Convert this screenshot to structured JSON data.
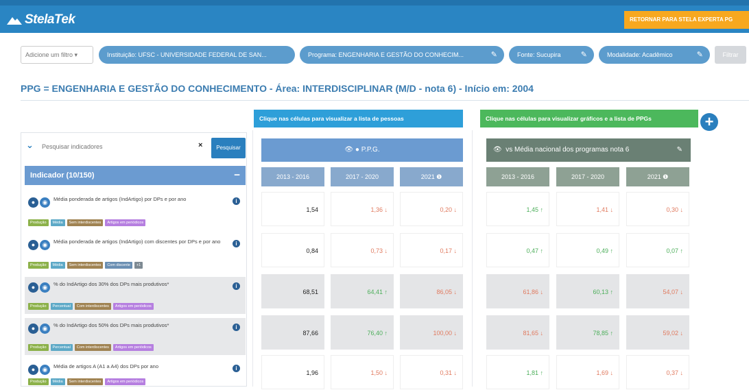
{
  "header": {
    "logo_text": "StelaTek",
    "back_button": "RETORNAR PARA STELA EXPERTA PG"
  },
  "filters": {
    "add_filter": "Adicione um filtro",
    "pills": [
      "Instituição: UFSC - UNIVERSIDADE FEDERAL DE SAN...",
      "Programa: ENGENHARIA E GESTÃO DO CONHECIM...",
      "Fonte: Sucupira",
      "Modalidade: Acadêmico"
    ],
    "disabled_button": "Filtrar"
  },
  "ppg_title": "PPG = ENGENHARIA E GESTÃO DO CONHECIMENTO - Área: INTERDISCIPLINAR (M/D - nota 6) - Início em: 2004",
  "hints": {
    "persons": "Clique nas células para visualizar a lista de pessoas",
    "charts": "Clique nas células para visualizar gráficos e a lista de PPGs"
  },
  "search": {
    "placeholder": "Pesquisar indicadores",
    "button": "Pesquisar"
  },
  "indicator_header": "Indicador (10/150)",
  "indicators": [
    {
      "text": "Média ponderada de artigos (IndArtigo) por DPs e por ano",
      "tags": [
        "Produção",
        "Média",
        "Sem interdiscentes",
        "Artigos em periódicos"
      ]
    },
    {
      "text": "Média ponderada de artigos (IndArtigo) com discentes por DPs e por ano",
      "tags": [
        "Produção",
        "Média",
        "Sem interdiscentes",
        "Com discente",
        "+1"
      ]
    },
    {
      "text": "% do IndArtigo dos 30% dos DPs mais produtivos*",
      "tags": [
        "Produção",
        "Percentual",
        "Com interdiscentes",
        "Artigos em periódicos"
      ]
    },
    {
      "text": "% do IndArtigo dos 50% dos DPs mais produtivos*",
      "tags": [
        "Produção",
        "Percentual",
        "Com interdiscentes",
        "Artigos em periódicos"
      ]
    },
    {
      "text": "Média de artigos A (A1 a A4) dos DPs por ano",
      "tags": [
        "Produção",
        "Média",
        "Sem interdiscentes",
        "Artigos em periódicos"
      ]
    }
  ],
  "tag_colors": {
    "Produção": "#8cb14a",
    "Média": "#5da9c7",
    "Percentual": "#5da9c7",
    "Sem interdiscentes": "#a08352",
    "Com interdiscentes": "#a08352",
    "Artigos em periódicos": "#b67fe0",
    "Com discente": "#6a8fb3",
    "+1": "#7e8a93"
  },
  "ppg_table": {
    "title": "P.P.G.",
    "columns": [
      "2013 - 2016",
      "2017 - 2020",
      "2021"
    ],
    "rows": [
      [
        {
          "v": "1,54",
          "c": "black"
        },
        {
          "v": "1,36",
          "c": "red",
          "a": "down"
        },
        {
          "v": "0,20",
          "c": "red",
          "a": "down"
        }
      ],
      [
        {
          "v": "0,84",
          "c": "black"
        },
        {
          "v": "0,73",
          "c": "red",
          "a": "down"
        },
        {
          "v": "0,17",
          "c": "red",
          "a": "down"
        }
      ],
      [
        {
          "v": "68,51",
          "c": "black"
        },
        {
          "v": "64,41",
          "c": "green",
          "a": "up"
        },
        {
          "v": "86,05",
          "c": "red",
          "a": "down"
        }
      ],
      [
        {
          "v": "87,66",
          "c": "black"
        },
        {
          "v": "76,40",
          "c": "green",
          "a": "up"
        },
        {
          "v": "100,00",
          "c": "red",
          "a": "down"
        }
      ],
      [
        {
          "v": "1,96",
          "c": "black"
        },
        {
          "v": "1,50",
          "c": "red",
          "a": "down"
        },
        {
          "v": "0,31",
          "c": "red",
          "a": "down"
        }
      ]
    ]
  },
  "national_table": {
    "title": "vs Média nacional dos programas nota 6",
    "columns": [
      "2013 - 2016",
      "2017 - 2020",
      "2021"
    ],
    "rows": [
      [
        {
          "v": "1,45",
          "c": "green",
          "a": "up"
        },
        {
          "v": "1,41",
          "c": "red",
          "a": "down"
        },
        {
          "v": "0,30",
          "c": "red",
          "a": "down"
        }
      ],
      [
        {
          "v": "0,47",
          "c": "green",
          "a": "up"
        },
        {
          "v": "0,49",
          "c": "green",
          "a": "up"
        },
        {
          "v": "0,07",
          "c": "green",
          "a": "up"
        }
      ],
      [
        {
          "v": "61,86",
          "c": "red",
          "a": "down"
        },
        {
          "v": "60,13",
          "c": "green",
          "a": "up"
        },
        {
          "v": "54,07",
          "c": "red",
          "a": "down"
        }
      ],
      [
        {
          "v": "81,65",
          "c": "red",
          "a": "down"
        },
        {
          "v": "78,85",
          "c": "green",
          "a": "up"
        },
        {
          "v": "59,02",
          "c": "red",
          "a": "down"
        }
      ],
      [
        {
          "v": "1,81",
          "c": "green",
          "a": "up"
        },
        {
          "v": "1,69",
          "c": "red",
          "a": "down"
        },
        {
          "v": "0,37",
          "c": "red",
          "a": "down"
        }
      ]
    ]
  }
}
